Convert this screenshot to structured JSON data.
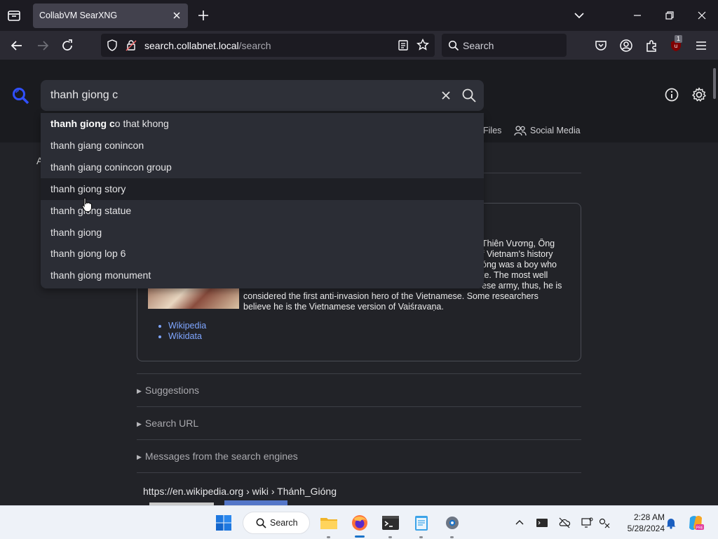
{
  "browser": {
    "tab_title": "CollabVM SearXNG",
    "url_host": "search.collabnet.local",
    "url_path": "/search",
    "search_placeholder": "Search",
    "extension_badge": "1"
  },
  "searxng": {
    "query": "thanh giong c",
    "categories": {
      "files": "Files",
      "social_media": "Social Media"
    },
    "partial_left_text": "A",
    "suggestions": [
      {
        "bold": "thanh giong c",
        "rest": "o that khong"
      },
      {
        "bold": "",
        "rest": "thanh giang conincon"
      },
      {
        "bold": "",
        "rest": "thanh giang conincon group"
      },
      {
        "bold": "",
        "rest": "thanh giong story"
      },
      {
        "bold": "",
        "rest": "thanh giong statue"
      },
      {
        "bold": "",
        "rest": "thanh giong"
      },
      {
        "bold": "",
        "rest": "thanh giong lop 6"
      },
      {
        "bold": "",
        "rest": "thanh giong monument"
      }
    ],
    "infobox": {
      "lines": [
        "Thiên Vương, Ông",
        "f Vietnam's history",
        "óng was a boy who",
        "te. The most well",
        "considered the first anti-invasion hero of the Vietnamese. Some researchers believe he is the Vietnamese version of Vaiśravaṇa."
      ],
      "line5_left": "considered the first anti-invasion hero of the Vietnamese",
      "line5_right": "ese army, thus, he is",
      "line6": "considered the first anti-invasion hero of the Vietnamese. Some researchers",
      "line7": "believe he is the Vietnamese version of Vaiśravaṇa.",
      "links": [
        "Wikipedia",
        "Wikidata"
      ]
    },
    "details": [
      "Suggestions",
      "Search URL",
      "Messages from the search engines"
    ],
    "result": {
      "host": "https://en.wikipedia.org",
      "path": " › wiki › Thánh_Gióng"
    }
  },
  "taskbar": {
    "search_label": "Search",
    "time": "2:28 AM",
    "date": "5/28/2024"
  },
  "colors": {
    "page_bg": "#222328",
    "header_bg": "#1a1b1f",
    "accent": "#5a7fd9",
    "link": "#7fa6ff"
  }
}
